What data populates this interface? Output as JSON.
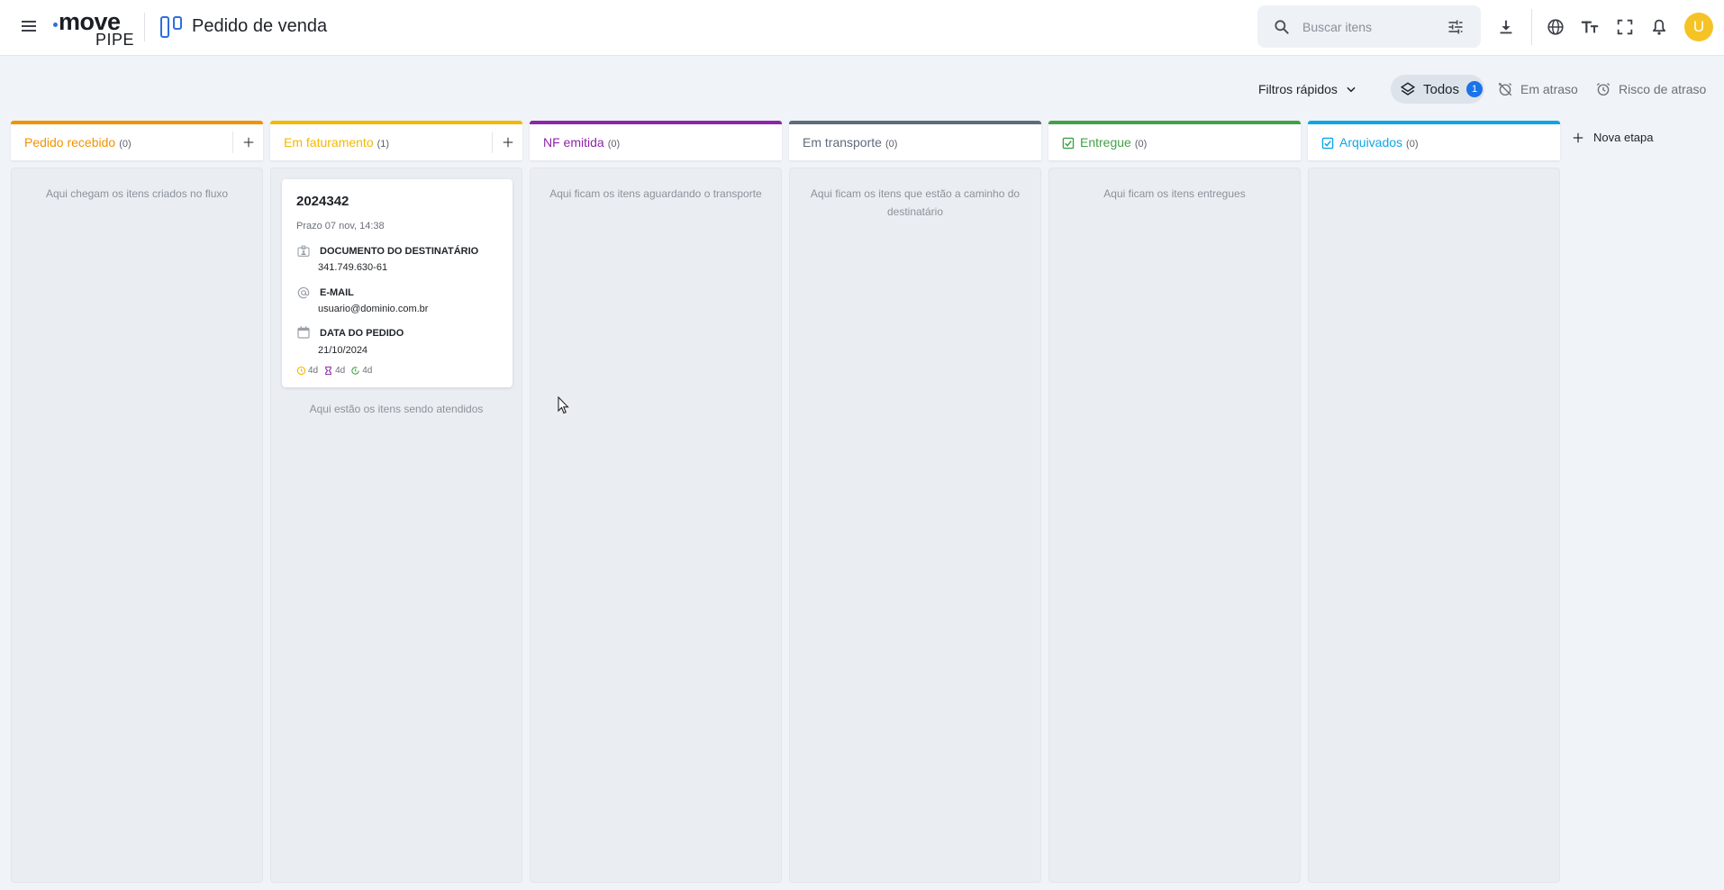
{
  "header": {
    "brand_move": "move",
    "brand_pipe": "PIPE",
    "title": "Pedido de venda",
    "search_placeholder": "Buscar itens",
    "avatar_initial": "U",
    "icons": [
      "menu-icon",
      "board-icon",
      "search-icon",
      "tune-icon",
      "download-icon",
      "globe-icon",
      "text-size-icon",
      "fullscreen-icon",
      "bell-icon"
    ]
  },
  "filters": {
    "quick_label": "Filtros rápidos",
    "todos_label": "Todos",
    "todos_count": "1",
    "late_label": "Em atraso",
    "risk_label": "Risco de atraso"
  },
  "columns": [
    {
      "name": "Pedido recebido",
      "count": "(0)",
      "color": "#f29200",
      "empty_text": "Aqui chegam os itens criados no fluxo"
    },
    {
      "name": "Em faturamento",
      "count": "(1)",
      "color": "#f5b800",
      "empty_text": "Aqui estão os itens sendo atendidos"
    },
    {
      "name": "NF emitida",
      "count": "(0)",
      "color": "#8e24aa",
      "empty_text": "Aqui ficam os itens aguardando o transporte"
    },
    {
      "name": "Em transporte",
      "count": "(0)",
      "color": "#5f6b7d",
      "empty_text": "Aqui ficam os itens que estão a caminho do destinatário"
    },
    {
      "name": "Entregue",
      "count": "(0)",
      "color": "#43a047",
      "empty_text": "Aqui ficam os itens entregues"
    },
    {
      "name": "Arquivados",
      "count": "(0)",
      "color": "#0ea5e9",
      "empty_text": ""
    }
  ],
  "new_stage_label": "Nova etapa",
  "card": {
    "id": "2024342",
    "due": "Prazo 07 nov, 14:38",
    "fields": [
      {
        "label": "DOCUMENTO DO DESTINATÁRIO",
        "value": "341.749.630-61",
        "icon": "id-card-icon"
      },
      {
        "label": "E-MAIL",
        "value": "usuario@dominio.com.br",
        "icon": "at-icon"
      },
      {
        "label": "DATA DO PEDIDO",
        "value": "21/10/2024",
        "icon": "calendar-icon"
      }
    ],
    "timers": [
      {
        "value": "4d",
        "color": "#f5b800",
        "icon": "clock-icon"
      },
      {
        "value": "4d",
        "color": "#8e24aa",
        "icon": "hourglass-icon"
      },
      {
        "value": "4d",
        "color": "#43a047",
        "icon": "timer-icon"
      }
    ]
  }
}
